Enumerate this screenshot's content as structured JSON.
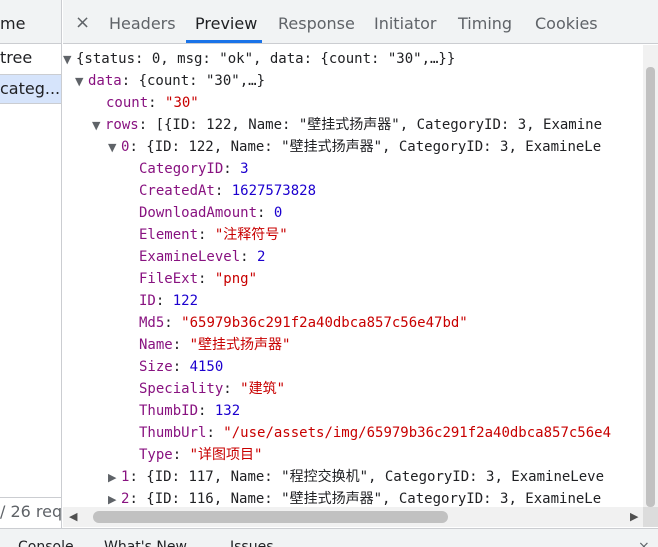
{
  "request_list": {
    "header_label": "me",
    "rows": [
      "tree",
      "categ..."
    ],
    "status_text": "/ 26 requ"
  },
  "tabs": {
    "close_glyph": "×",
    "items": [
      "Headers",
      "Preview",
      "Response",
      "Initiator",
      "Timing",
      "Cookies"
    ],
    "active": "Preview"
  },
  "preview": {
    "root_summary": "{status: 0, msg: \"ok\", data: {count: \"30\",…}}",
    "data_key": "data",
    "data_summary": "{count: \"30\",…}",
    "count_key": "count",
    "count_value": "\"30\"",
    "rows_key": "rows",
    "rows_summary": "[{ID: 122, Name: \"壁挂式扬声器\", CategoryID: 3, Examine",
    "item0_key": "0",
    "item0_summary": "{ID: 122, Name: \"壁挂式扬声器\", CategoryID: 3, ExamineLe",
    "fields": [
      {
        "key": "CategoryID",
        "value": "3",
        "type": "number"
      },
      {
        "key": "CreatedAt",
        "value": "1627573828",
        "type": "number"
      },
      {
        "key": "DownloadAmount",
        "value": "0",
        "type": "number"
      },
      {
        "key": "Element",
        "value": "\"注释符号\"",
        "type": "string"
      },
      {
        "key": "ExamineLevel",
        "value": "2",
        "type": "number"
      },
      {
        "key": "FileExt",
        "value": "\"png\"",
        "type": "string"
      },
      {
        "key": "ID",
        "value": "122",
        "type": "number"
      },
      {
        "key": "Md5",
        "value": "\"65979b36c291f2a40dbca857c56e47bd\"",
        "type": "string"
      },
      {
        "key": "Name",
        "value": "\"壁挂式扬声器\"",
        "type": "string"
      },
      {
        "key": "Size",
        "value": "4150",
        "type": "number"
      },
      {
        "key": "Speciality",
        "value": "\"建筑\"",
        "type": "string"
      },
      {
        "key": "ThumbID",
        "value": "132",
        "type": "number"
      },
      {
        "key": "ThumbUrl",
        "value": "\"/use/assets/img/65979b36c291f2a40dbca857c56e4",
        "type": "string"
      },
      {
        "key": "Type",
        "value": "\"详图项目\"",
        "type": "string"
      }
    ],
    "collapsed_items": [
      {
        "key": "1",
        "summary": "{ID: 117, Name: \"程控交换机\", CategoryID: 3, ExamineLeve"
      },
      {
        "key": "2",
        "summary": "{ID: 116, Name: \"壁挂式扬声器\", CategoryID: 3, ExamineLe"
      }
    ]
  },
  "drawer": {
    "tabs": [
      "Console",
      "What's New",
      "Issues"
    ],
    "close_glyph": "×"
  },
  "colors": {
    "key": "#881280",
    "string": "#c80000",
    "number": "#1c00cf",
    "accent": "#1a73e8",
    "selected_row": "#d6e4fb"
  },
  "icons": {
    "expanded": "▼",
    "collapsed": "▶",
    "scroll_left": "◀",
    "scroll_right": "▶"
  }
}
